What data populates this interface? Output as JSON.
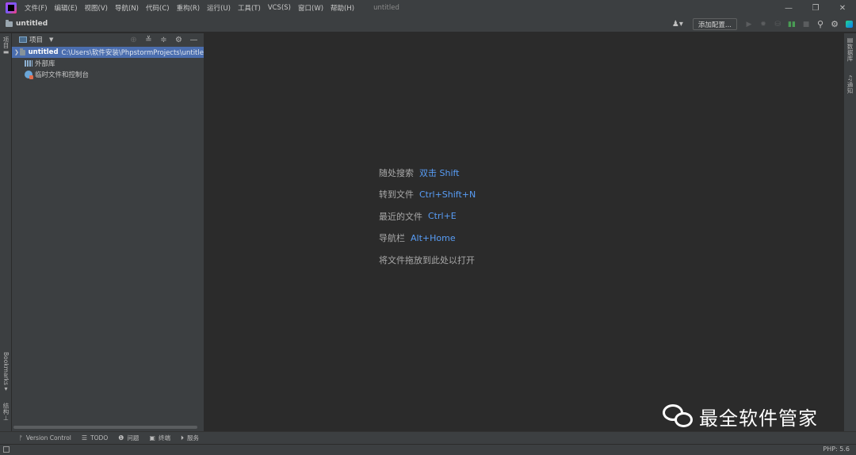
{
  "menubar": {
    "items": [
      "文件(F)",
      "编辑(E)",
      "视图(V)",
      "导航(N)",
      "代码(C)",
      "重构(R)",
      "运行(U)",
      "工具(T)",
      "VCS(S)",
      "窗口(W)",
      "帮助(H)"
    ],
    "window_title": "untitled",
    "minimize": "—",
    "restore": "❐",
    "close": "✕"
  },
  "navbar": {
    "crumb": "untitled",
    "user_icon": "♟▾",
    "add_config_label": "添加配置...",
    "icons": [
      "▶",
      "✹",
      "⛁",
      "▮▮",
      "■"
    ],
    "search_icon": "⚲",
    "settings_icon": "⚙"
  },
  "left_stripe": {
    "project_tab": "项目",
    "bookmarks_tab": "Bookmarks",
    "structure_tab": "结构"
  },
  "project_panel": {
    "title": "项目",
    "dropdown": "▼",
    "tools": [
      "⊕",
      "≚",
      "≑",
      "⚙",
      "—"
    ],
    "tree": {
      "root_name": "untitled",
      "root_path": "C:\\Users\\软件安装\\PhpstormProjects\\untitle",
      "external_libs": "外部库",
      "scratches": "临时文件和控制台"
    }
  },
  "editor_hints": [
    {
      "label": "随处搜索",
      "key": "双击 Shift"
    },
    {
      "label": "转到文件",
      "key": "Ctrl+Shift+N"
    },
    {
      "label": "最近的文件",
      "key": "Ctrl+E"
    },
    {
      "label": "导航栏",
      "key": "Alt+Home"
    },
    {
      "label": "将文件拖放到此处以打开",
      "key": ""
    }
  ],
  "right_stripe": {
    "database_tab": "数据库",
    "notifications_tab": "通知"
  },
  "bottom_tools": [
    {
      "icon": "ᚠ",
      "label": "Version Control"
    },
    {
      "icon": "☰",
      "label": "TODO"
    },
    {
      "icon": "❶",
      "label": "问题"
    },
    {
      "icon": "▣",
      "label": "终端"
    },
    {
      "icon": "⏵",
      "label": "服务"
    }
  ],
  "status": {
    "php_version": "PHP: 5.6"
  },
  "watermark": {
    "text": "最全软件管家"
  }
}
